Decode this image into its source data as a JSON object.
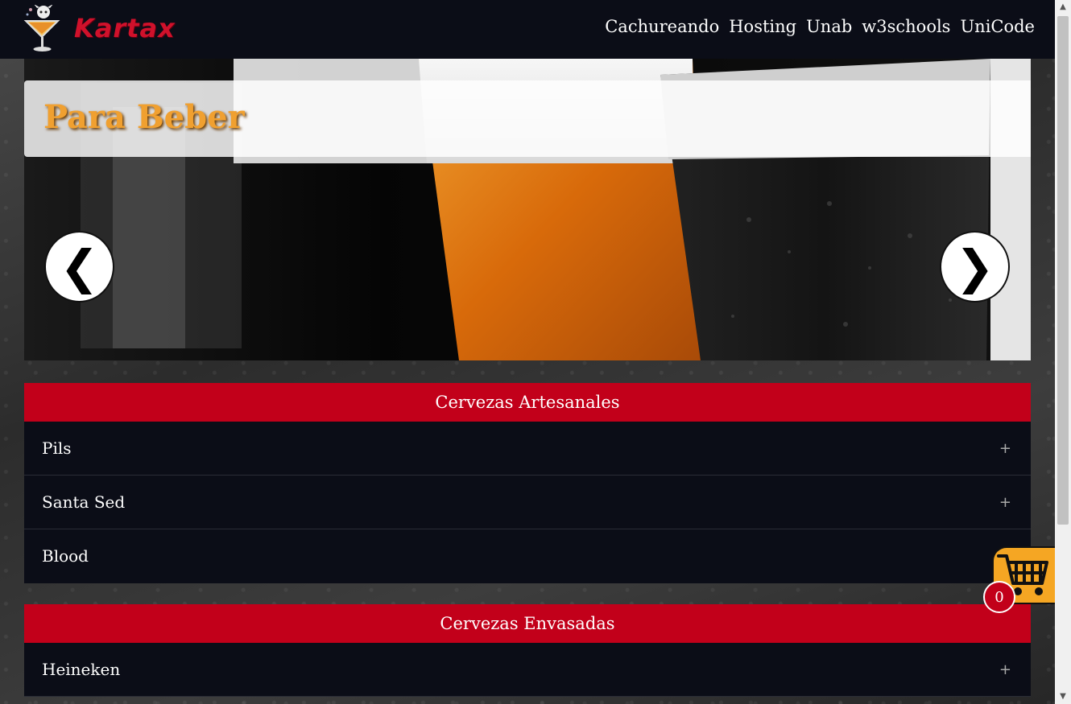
{
  "header": {
    "brand": "Kartax",
    "nav": [
      "Cachureando",
      "Hosting",
      "Unab",
      "w3schools",
      "UniCode"
    ]
  },
  "hero": {
    "title": "Para Beber",
    "prev_glyph": "❮",
    "next_glyph": "❯"
  },
  "sections": [
    {
      "title": "Cervezas Artesanales",
      "items": [
        "Pils",
        "Santa Sed",
        "Blood"
      ]
    },
    {
      "title": "Cervezas Envasadas",
      "items": [
        "Heineken"
      ]
    }
  ],
  "item_toggle": "+",
  "cart": {
    "count": "0"
  },
  "scrollbar": {
    "up": "▲",
    "down": "▼"
  },
  "colors": {
    "accent": "#c2001a",
    "bar": "#0b0d17",
    "cart": "#f5a623",
    "hero_title": "#f0a030"
  }
}
